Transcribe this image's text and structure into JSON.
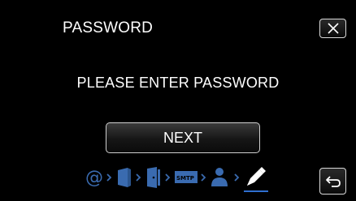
{
  "screen": {
    "title": "PASSWORD",
    "prompt": "PLEASE ENTER PASSWORD",
    "next_label": "NEXT"
  },
  "steps": {
    "icons": [
      "at-sign-icon",
      "server-icon",
      "door-icon",
      "smtp-icon",
      "user-icon",
      "pen-icon"
    ],
    "smtp_label": "SMTP",
    "at_label": "@",
    "active_step": "pen-icon"
  },
  "colors": {
    "background": "#000000",
    "step_inactive": "#3a6bb0",
    "step_active": "#ffffff",
    "active_underline": "#2f6fd0"
  }
}
